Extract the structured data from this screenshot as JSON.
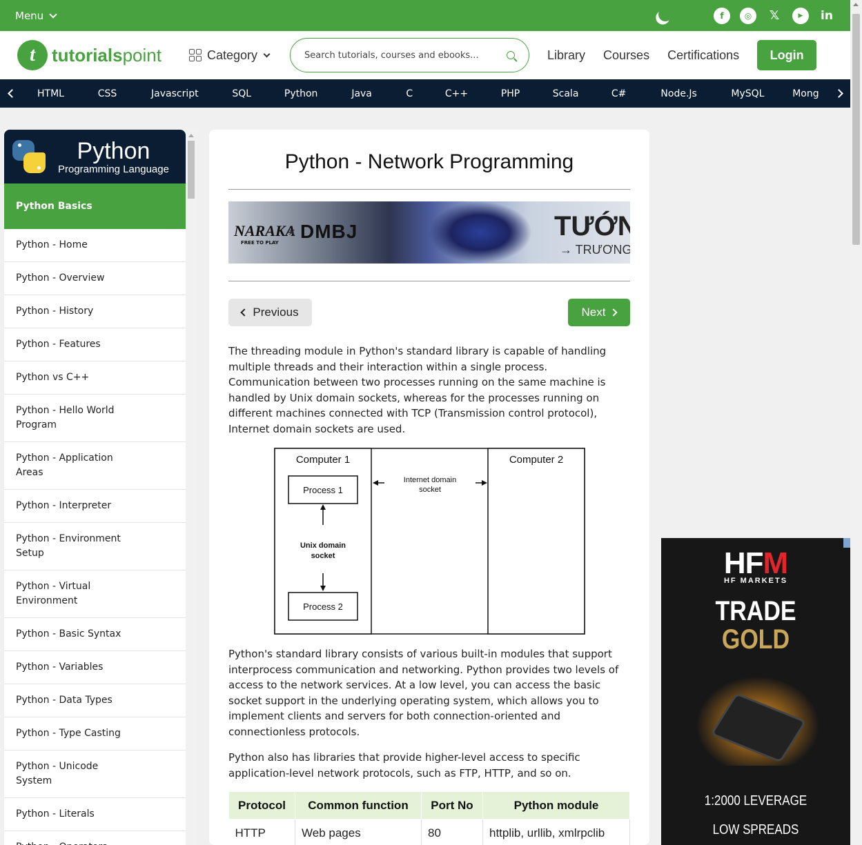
{
  "topbar": {
    "menu_label": "Menu",
    "socials": [
      "facebook",
      "instagram",
      "x",
      "youtube",
      "linkedin"
    ],
    "social_glyphs": {
      "facebook": "f",
      "instagram": "◎",
      "x": "𝕏",
      "youtube": "▶",
      "linkedin": "in"
    }
  },
  "header": {
    "logo_word1": "tutorials",
    "logo_word2": "point",
    "category_label": "Category",
    "search_placeholder": "Search tutorials, courses and ebooks...",
    "nav": [
      "Library",
      "Courses",
      "Certifications"
    ],
    "login_label": "Login"
  },
  "langnav": {
    "items": [
      "HTML",
      "CSS",
      "Javascript",
      "SQL",
      "Python",
      "Java",
      "C",
      "C++",
      "PHP",
      "Scala",
      "C#",
      "Node.Js",
      "MySQL",
      "Mong"
    ]
  },
  "sidebar": {
    "title": "Python",
    "subtitle": "Programming Language",
    "section": "Python Basics",
    "items": [
      "Python - Home",
      "Python - Overview",
      "Python - History",
      "Python - Features",
      "Python vs C++",
      "Python - Hello World Program",
      "Python - Application Areas",
      "Python - Interpreter",
      "Python - Environment Setup",
      "Python - Virtual Environment",
      "Python - Basic Syntax",
      "Python - Variables",
      "Python - Data Types",
      "Python - Type Casting",
      "Python - Unicode System",
      "Python - Literals",
      "Python - Operators"
    ]
  },
  "main": {
    "title": "Python - Network Programming",
    "banner": {
      "brand1": "NARAKA",
      "brand1_sub": "FREE TO PLAY",
      "times": "×",
      "brand2": "DMBJ",
      "headline": "TƯỚN",
      "subline": "→ TRƯƠNG"
    },
    "prev_label": "Previous",
    "next_label": "Next",
    "para1": "The threading module in Python's standard library is capable of handling multiple threads and their interaction within a single process. Communication between two processes running on the same machine is handled by Unix domain sockets, whereas for the processes running on different machines connected with TCP (Transmission control protocol), Internet domain sockets are used.",
    "diagram": {
      "computer1": "Computer 1",
      "computer2": "Computer 2",
      "process1": "Process 1",
      "process2": "Process 2",
      "unix_line1": "Unix domain",
      "unix_line2": "socket",
      "inet_line1": "Internet domain",
      "inet_line2": "socket"
    },
    "para2": "Python's standard library consists of various built-in modules that support interprocess communication and networking. Python provides two levels of access to the network services. At a low level, you can access the basic socket support in the underlying operating system, which allows you to implement clients and servers for both connection-oriented and connectionless protocols.",
    "para3": "Python also has libraries that provide higher-level access to specific application-level network protocols, such as FTP, HTTP, and so on.",
    "table": {
      "headers": [
        "Protocol",
        "Common function",
        "Port No",
        "Python module"
      ],
      "rows": [
        [
          "HTTP",
          "Web pages",
          "80",
          "httplib, urllib, xmlrpclib"
        ]
      ]
    }
  },
  "ad": {
    "brand_a": "HF",
    "brand_b": "M",
    "brand_sub": "HF MARKETS",
    "line1": "TRADE",
    "line2": "GOLD",
    "leverage": "1:2000 LEVERAGE",
    "spreads": "LOW SPREADS",
    "colors": {
      "gold": "#c9a75a",
      "red": "#e3242b"
    }
  },
  "colors": {
    "brand_green": "#48a23f",
    "navy": "#0b1d33"
  }
}
